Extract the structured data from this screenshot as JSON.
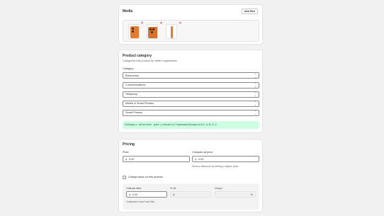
{
  "media": {
    "title": "Media",
    "add_files_label": "Add files",
    "remove_glyph": "×",
    "thumbnails": [
      {
        "name": "orange-phone-front",
        "color": "#e57a2e"
      },
      {
        "name": "orange-phone-back",
        "color": "#e57a2e"
      },
      {
        "name": "orange-phone-side",
        "color": "#e57a2e"
      }
    ]
  },
  "category": {
    "title": "Product category",
    "description": "Categorize this product for better organization",
    "field_label": "Category",
    "selects": [
      "Electronics",
      "Communications",
      "Telephony",
      "Mobile & Smart Phones",
      "Smart Phones"
    ],
    "selected_message": "Category selected: gid://shopify/TaxonomyCategory/el-4-8-5-2"
  },
  "pricing": {
    "title": "Pricing",
    "price_label": "Price",
    "price_currency": "₹",
    "price_value": "0.00",
    "compare_label": "Compare-at price",
    "compare_currency": "₹",
    "compare_value": "0.00",
    "compare_help": "Show a discount by setting a higher price",
    "charge_taxes_label": "Charge taxes on this product",
    "cost_label": "Cost per item",
    "cost_currency": "₹",
    "cost_value": "0.00",
    "cost_help": "Customers won't see this",
    "profit_label": "Profit",
    "profit_currency": "₹",
    "margin_label": "Margin",
    "margin_suffix": "%"
  },
  "colors": {
    "success_banner": "#cdfee1",
    "remove_icon": "#c62a2a",
    "card_bg": "#ffffff",
    "page_bg": "#f1f1f1"
  }
}
